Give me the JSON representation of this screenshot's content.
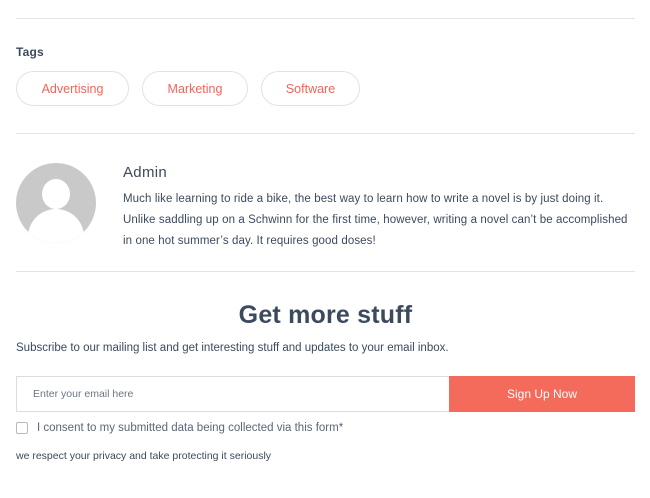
{
  "tags_section": {
    "label": "Tags",
    "tags": [
      "Advertising",
      "Marketing",
      "Software"
    ]
  },
  "author": {
    "name": "Admin",
    "bio": "Much like learning to ride a bike, the best way to learn how to write a novel is by just doing it. Unlike saddling up on a Schwinn for the first time, however, writing a novel can’t be accomplished in one hot summer’s day. It requires good doses!"
  },
  "subscribe": {
    "title": "Get more stuff",
    "description": "Subscribe to our mailing list and get interesting stuff and updates to your email inbox.",
    "email_placeholder": "Enter your email here",
    "email_value": "",
    "button_label": "Sign Up Now",
    "consent_label": "I consent to my submitted data being collected via this form*",
    "consent_checked": false,
    "privacy_note": "we respect your privacy and take protecting it seriously"
  },
  "colors": {
    "accent": "#f46a5b",
    "tag_text": "#f0645a",
    "text": "#3b4a5e",
    "divider": "#e3e3e3"
  }
}
